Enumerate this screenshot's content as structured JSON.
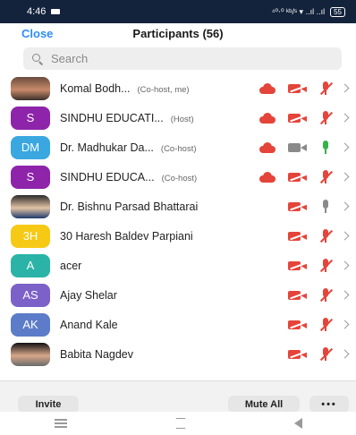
{
  "status_bar": {
    "time": "4:46",
    "indicators": "⁴⁰⋅⁰ ᵏᵇ/ˢ  ▾ ..ıl ..ıl",
    "battery": "55"
  },
  "header": {
    "close_label": "Close",
    "title": "Participants (56)"
  },
  "search": {
    "placeholder": "Search"
  },
  "participants": [
    {
      "initials": "",
      "avatar_type": "photo",
      "avatar_color": "#c78a6a",
      "name": "Komal Bodh...",
      "role": "(Co-host, me)",
      "cloud": true,
      "video": "off",
      "mic": "muted"
    },
    {
      "initials": "S",
      "avatar_type": "initials",
      "avatar_color": "#8e24aa",
      "name": "SINDHU EDUCATI...",
      "role": "(Host)",
      "cloud": true,
      "video": "off",
      "mic": "muted"
    },
    {
      "initials": "DM",
      "avatar_type": "initials",
      "avatar_color": "#3aa7e0",
      "name": "Dr. Madhukar Da...",
      "role": "(Co-host)",
      "cloud": true,
      "video": "gray",
      "mic": "green"
    },
    {
      "initials": "S",
      "avatar_type": "initials",
      "avatar_color": "#8e24aa",
      "name": "SINDHU EDUCA...",
      "role": "(Co-host)",
      "cloud": true,
      "video": "off",
      "mic": "muted"
    },
    {
      "initials": "",
      "avatar_type": "photo2",
      "avatar_color": "#e2c3a5",
      "name": "Dr. Bishnu Parsad Bhattarai",
      "role": "",
      "cloud": false,
      "video": "off",
      "mic": "gray"
    },
    {
      "initials": "3H",
      "avatar_type": "initials",
      "avatar_color": "#f6c915",
      "name": "30 Haresh Baldev Parpiani",
      "role": "",
      "cloud": false,
      "video": "off",
      "mic": "muted"
    },
    {
      "initials": "A",
      "avatar_type": "initials",
      "avatar_color": "#2ab3a6",
      "name": "acer",
      "role": "",
      "cloud": false,
      "video": "off",
      "mic": "muted"
    },
    {
      "initials": "AS",
      "avatar_type": "initials",
      "avatar_color": "#7b61c8",
      "name": "Ajay Shelar",
      "role": "",
      "cloud": false,
      "video": "off",
      "mic": "muted"
    },
    {
      "initials": "AK",
      "avatar_type": "initials",
      "avatar_color": "#5c7cc9",
      "name": "Anand Kale",
      "role": "",
      "cloud": false,
      "video": "off",
      "mic": "muted"
    },
    {
      "initials": "",
      "avatar_type": "photo3",
      "avatar_color": "#d7a789",
      "name": "Babita Nagdev",
      "role": "",
      "cloud": false,
      "video": "off",
      "mic": "muted"
    }
  ],
  "footer": {
    "invite_label": "Invite",
    "mute_all_label": "Mute All",
    "more_label": "•••"
  },
  "colors": {
    "accent": "#2d8cff",
    "muted_red": "#e5443a",
    "unmuted_green": "#33b34a",
    "status_bar_bg": "#14233c"
  }
}
